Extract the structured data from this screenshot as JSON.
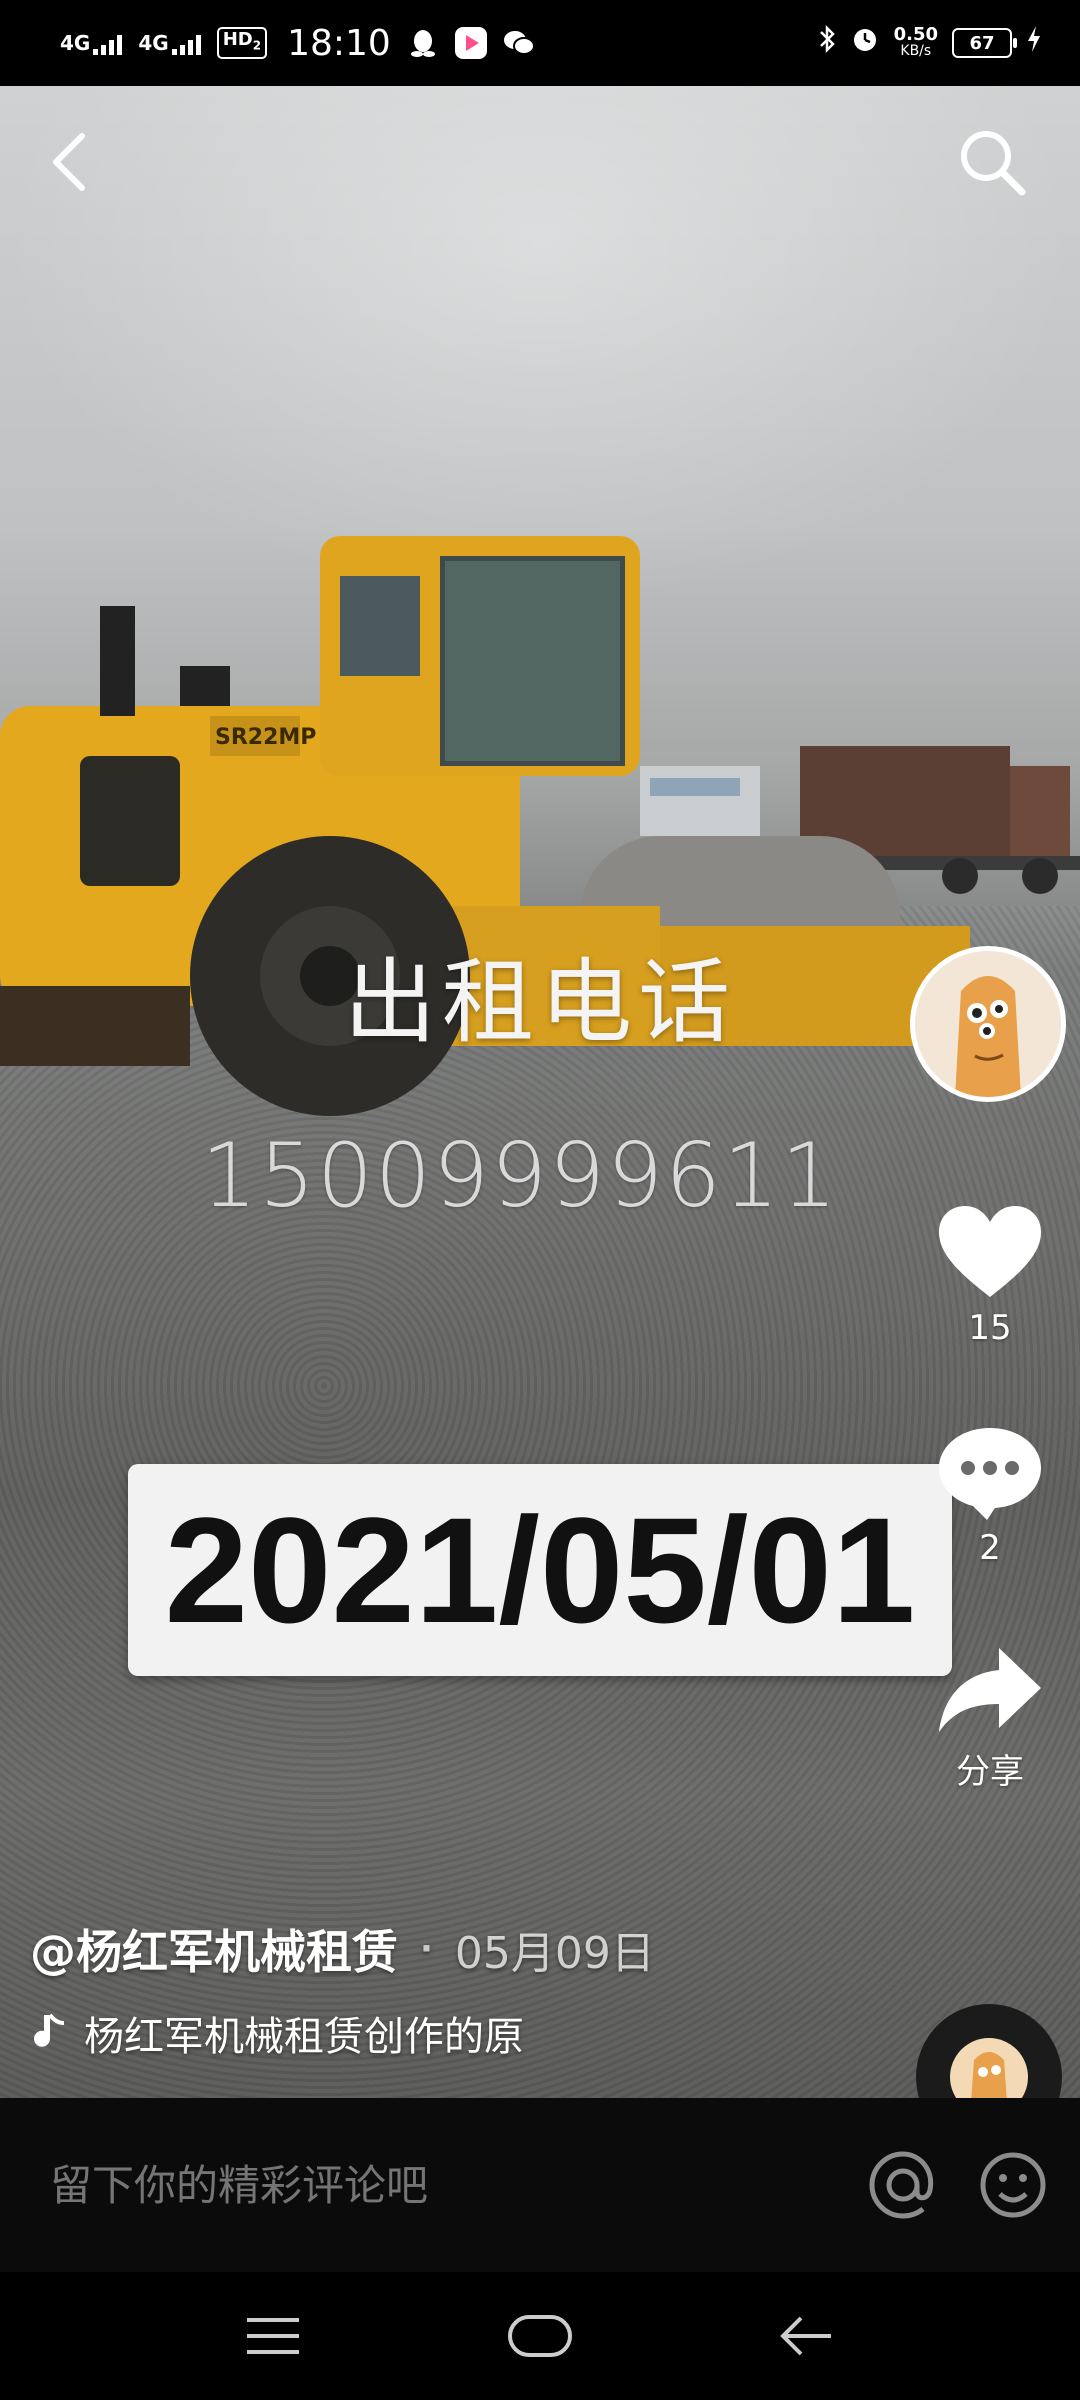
{
  "status_bar": {
    "network1": "4G",
    "network2": "4G",
    "hd_label": "HD",
    "hd_sub": "2",
    "time": "18:10",
    "speed_value": "0.50",
    "speed_unit": "KB/s",
    "battery": "67"
  },
  "video": {
    "overlay_title": "出租电话",
    "overlay_phone": "15009999611",
    "date_caption": "2021/05/01"
  },
  "rail": {
    "like_count": "15",
    "comment_count": "2",
    "share_label": "分享"
  },
  "post": {
    "author": "@杨红军机械租赁",
    "date": "05月09日",
    "music_text": "杨红军机械租赁创作的原"
  },
  "comment_bar": {
    "placeholder": "留下你的精彩评论吧"
  },
  "colors": {
    "roller_yellow": "#e3a81e",
    "background": "#000000",
    "placeholder_gray": "#8c8c8c"
  },
  "icons": [
    "back-arrow-icon",
    "search-icon",
    "heart-icon",
    "comment-icon",
    "share-icon",
    "music-note-icon",
    "at-icon",
    "emoji-icon",
    "menu-icon",
    "home-icon",
    "back-icon"
  ]
}
